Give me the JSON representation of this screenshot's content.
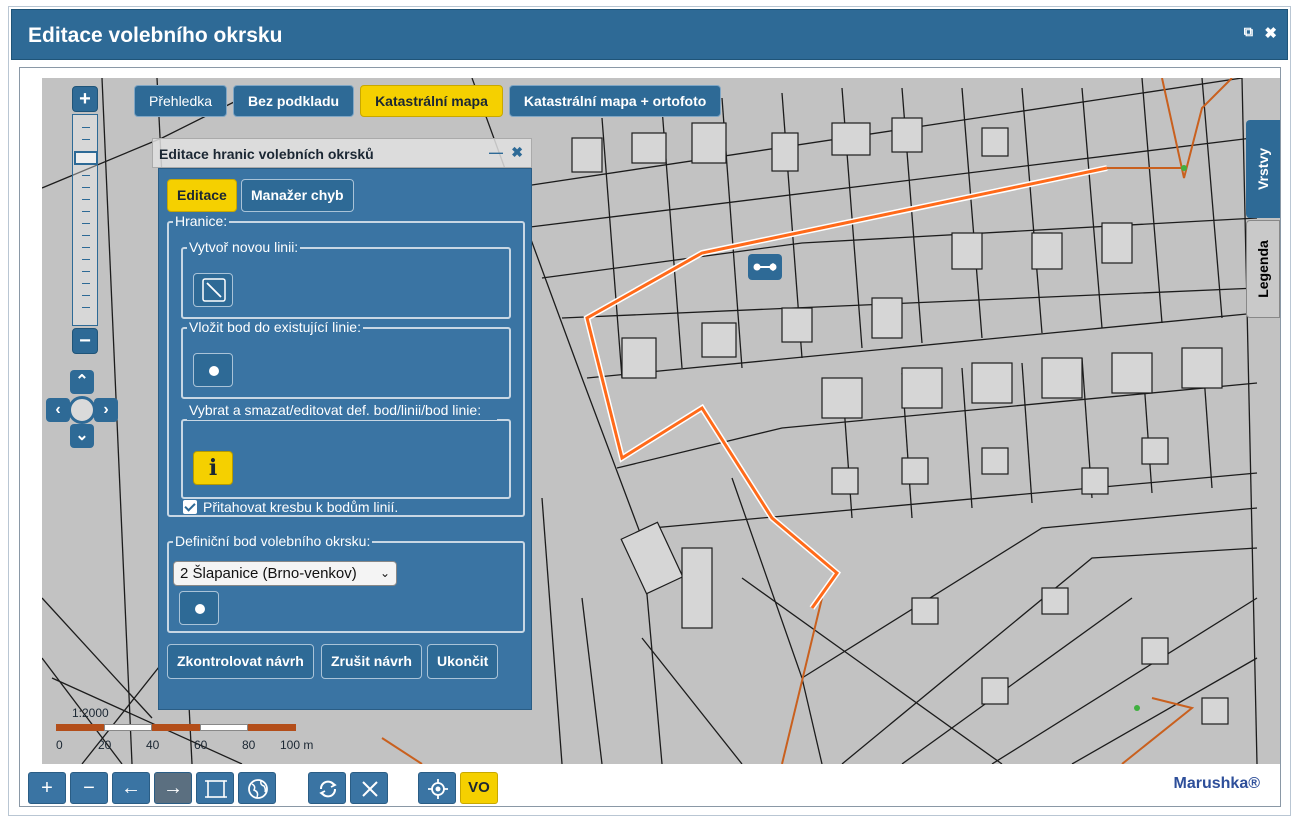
{
  "window": {
    "title": "Editace volebního okrsku",
    "popout_icon": "⧉",
    "close_icon": "✖"
  },
  "map": {
    "zoom_in": "+",
    "zoom_out": "−",
    "tabs": [
      "Přehledka",
      "Bez podkladu",
      "Katastrální mapa",
      "Katastrální mapa + ortofoto"
    ],
    "active_tab": "Katastrální mapa",
    "side_tabs": [
      "Vrstvy",
      "Legenda"
    ]
  },
  "panel": {
    "title": "Editace hranic volebních okrsků",
    "tabs": [
      "Editace",
      "Manažer chyb"
    ],
    "section_hranice": "Hranice:",
    "group_new_line": "Vytvoř novou linii:",
    "group_insert_point": "Vložit bod do existující linie:",
    "group_select": "Vybrat a smazat/editovat def. bod/linii/bod linie:",
    "checkbox_label": "Přitahovat kresbu k bodům linií.",
    "section_definition": "Definiční bod volebního okrsku:",
    "select_value": "2 Šlapanice (Brno-venkov)",
    "info_icon_glyph": "i",
    "buttons": [
      "Zkontrolovat návrh",
      "Zrušit návrh",
      "Ukončit"
    ]
  },
  "scale": {
    "ratio": "1:2000",
    "labels": [
      "0",
      "20",
      "40",
      "60",
      "80",
      "100 m"
    ]
  },
  "toolbar": {
    "zoom_in": "+",
    "zoom_out": "−",
    "back": "←",
    "forward": "→",
    "vo": "VO"
  },
  "brand": "Marushka®",
  "colors": {
    "primary": "#2e6a96",
    "accent": "#f5d000",
    "boundary": "#ff6a1a"
  }
}
